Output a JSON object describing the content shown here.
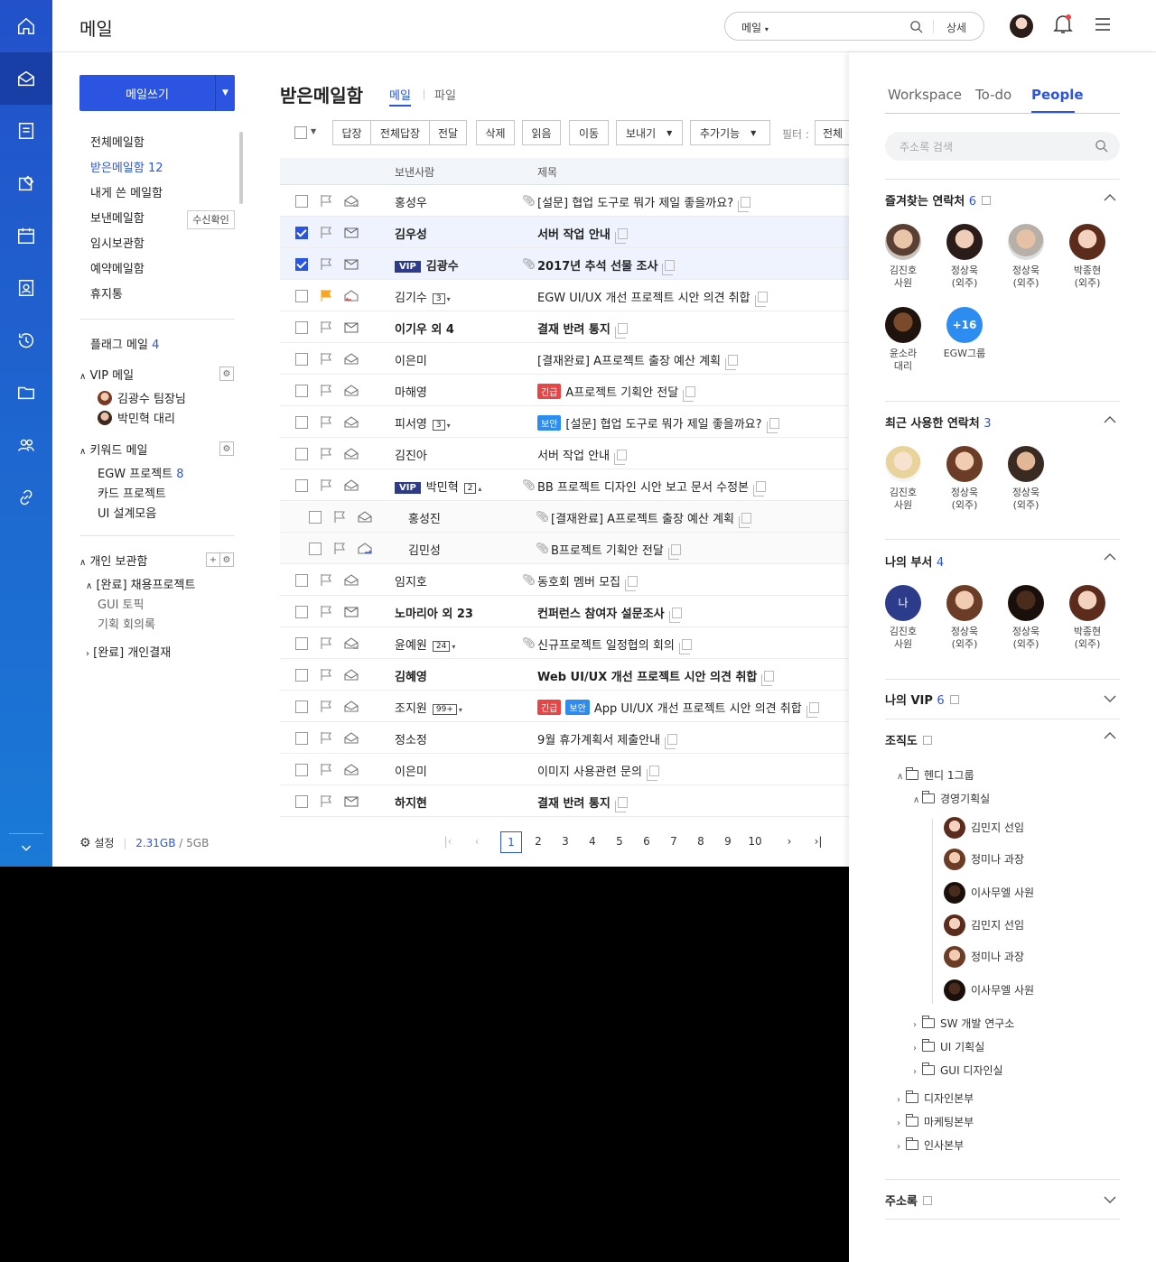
{
  "app": {
    "title": "메일"
  },
  "search": {
    "scope": "메일",
    "detail": "상세"
  },
  "rail": [
    "home-icon",
    "mail-icon",
    "board-icon",
    "approval-icon",
    "calendar-icon",
    "contacts-icon",
    "history-icon",
    "folder-icon",
    "people-icon",
    "link-icon",
    "chevron-down-icon"
  ],
  "compose": {
    "label": "메일쓰기"
  },
  "nav": {
    "items": [
      {
        "label": "전체메일함",
        "count": ""
      },
      {
        "label": "받은메일함",
        "count": "12"
      },
      {
        "label": "내게 쓴 메일함",
        "count": ""
      },
      {
        "label": "보낸메일함",
        "count": ""
      },
      {
        "label": "임시보관함",
        "count": ""
      },
      {
        "label": "예약메일함",
        "count": ""
      },
      {
        "label": "휴지통",
        "count": ""
      }
    ],
    "receipt_button": "수신확인",
    "flag_mail": {
      "label": "플래그 메일",
      "count": "4"
    },
    "vip": {
      "label": "VIP 메일",
      "people": [
        "김광수 팀장님",
        "박민혁 대리"
      ]
    },
    "keyword": {
      "label": "키워드 메일",
      "items": [
        {
          "label": "EGW 프로젝트",
          "count": "8"
        },
        {
          "label": "카드 프로젝트",
          "count": ""
        },
        {
          "label": "UI 설계모음",
          "count": ""
        }
      ]
    },
    "personal": {
      "label": "개인 보관함",
      "group1": "[완료] 채용프로젝트",
      "sub": [
        "GUI 토픽",
        "기획 회의록"
      ],
      "group2": "[완료] 개인결재"
    }
  },
  "footer": {
    "settings": "설정",
    "used": "2.31GB",
    "sep": "/",
    "total": "5GB"
  },
  "mailbox": {
    "title": "받은메일함",
    "tab_mail": "메일",
    "tab_file": "파일"
  },
  "toolbar": {
    "reply": "답장",
    "reply_all": "전체답장",
    "forward": "전달",
    "delete": "삭제",
    "read": "읽음",
    "move": "이동",
    "send": "보내기",
    "more": "추가기능",
    "filter_label": "필터 :",
    "filter_value": "전체"
  },
  "table": {
    "headers": {
      "sender": "보낸사람",
      "subject": "제목"
    },
    "rows": [
      {
        "sender": "홍성우",
        "subject": "[설문] 협업 도구로 뭐가 제일 좋을까요?",
        "bold": false,
        "checked": false,
        "clip": true,
        "flag": false,
        "env": "open-cc",
        "vip": false,
        "count": "",
        "tags": []
      },
      {
        "sender": "김우성",
        "subject": "서버 작업 안내",
        "bold": true,
        "checked": true,
        "clip": false,
        "flag": false,
        "env": "closed",
        "vip": false,
        "count": "",
        "tags": []
      },
      {
        "sender": "김광수",
        "subject": "2017년 추석 선물 조사",
        "bold": true,
        "checked": true,
        "clip": true,
        "flag": false,
        "env": "closed",
        "vip": true,
        "count": "",
        "tags": []
      },
      {
        "sender": "김기수",
        "subject": "EGW UI/UX 개선 프로젝트 시안 의견 취합",
        "bold": false,
        "checked": false,
        "clip": false,
        "flag": true,
        "env": "open-reply",
        "vip": false,
        "count": "3",
        "tags": []
      },
      {
        "sender": "이기우 외 4",
        "subject": "결재 반려 통지",
        "bold": true,
        "checked": false,
        "clip": false,
        "flag": false,
        "env": "closed",
        "vip": false,
        "count": "",
        "tags": []
      },
      {
        "sender": "이은미",
        "subject": "[결재완료] A프로젝트 출장 예산 계획",
        "bold": false,
        "checked": false,
        "clip": false,
        "flag": false,
        "env": "open",
        "vip": false,
        "count": "",
        "tags": []
      },
      {
        "sender": "마해영",
        "subject": "A프로젝트 기획안 전달",
        "bold": false,
        "checked": false,
        "clip": false,
        "flag": false,
        "env": "open",
        "vip": false,
        "count": "",
        "tags": [
          "긴급"
        ]
      },
      {
        "sender": "피서영",
        "subject": "[설문] 협업 도구로 뭐가 제일 좋을까요?",
        "bold": false,
        "checked": false,
        "clip": false,
        "flag": false,
        "env": "open",
        "vip": false,
        "count": "3",
        "tags": [
          "보안"
        ]
      },
      {
        "sender": "김진아",
        "subject": "서버 작업 안내",
        "bold": false,
        "checked": false,
        "clip": false,
        "flag": false,
        "env": "open",
        "vip": false,
        "count": "",
        "tags": []
      },
      {
        "sender": "박민혁",
        "subject": "BB 프로젝트 디자인 시안 보고 문서 수정본",
        "bold": false,
        "checked": false,
        "clip": true,
        "flag": false,
        "env": "open",
        "vip": true,
        "count": "2",
        "tags": []
      },
      {
        "sender": "홍성진",
        "subject": "[결재완료] A프로젝트 출장 예산 계획",
        "bold": false,
        "checked": false,
        "clip": true,
        "flag": false,
        "env": "open",
        "vip": false,
        "count": "",
        "tags": [],
        "child": true
      },
      {
        "sender": "김민성",
        "subject": "B프로젝트 기획안 전달",
        "bold": false,
        "checked": false,
        "clip": true,
        "flag": false,
        "env": "open-fwd",
        "vip": false,
        "count": "",
        "tags": [],
        "child": true
      },
      {
        "sender": "임지호",
        "subject": "동호회 멤버 모집",
        "bold": false,
        "checked": false,
        "clip": true,
        "flag": false,
        "env": "open",
        "vip": false,
        "count": "",
        "tags": []
      },
      {
        "sender": "노마리아 외 23",
        "subject": "컨퍼런스 참여자 설문조사",
        "bold": true,
        "checked": false,
        "clip": false,
        "flag": false,
        "env": "closed",
        "vip": false,
        "count": "",
        "tags": []
      },
      {
        "sender": "윤예원",
        "subject": "신규프로젝트 일정협의 회의",
        "bold": false,
        "checked": false,
        "clip": true,
        "flag": false,
        "env": "open-cc",
        "vip": false,
        "count": "24",
        "tags": []
      },
      {
        "sender": "김혜영",
        "subject": "Web UI/UX 개선 프로젝트 시안 의견 취합",
        "bold": true,
        "checked": false,
        "clip": false,
        "flag": false,
        "env": "open",
        "vip": false,
        "count": "",
        "tags": []
      },
      {
        "sender": "조지원",
        "subject": "App UI/UX 개선 프로젝트 시안 의견 취합",
        "bold": false,
        "checked": false,
        "clip": false,
        "flag": false,
        "env": "open",
        "vip": false,
        "count": "99+",
        "tags": [
          "긴급",
          "보안"
        ]
      },
      {
        "sender": "정소정",
        "subject": "9월 휴가계획서 제출안내",
        "bold": false,
        "checked": false,
        "clip": false,
        "flag": false,
        "env": "open",
        "vip": false,
        "count": "",
        "tags": []
      },
      {
        "sender": "이은미",
        "subject": "이미지 사용관련 문의",
        "bold": false,
        "checked": false,
        "clip": false,
        "flag": false,
        "env": "open",
        "vip": false,
        "count": "",
        "tags": []
      },
      {
        "sender": "하지현",
        "subject": "결재 반려 통지",
        "bold": true,
        "checked": false,
        "clip": false,
        "flag": false,
        "env": "closed",
        "vip": false,
        "count": "",
        "tags": []
      }
    ]
  },
  "pagination": {
    "pages": [
      "1",
      "2",
      "3",
      "4",
      "5",
      "6",
      "7",
      "8",
      "9",
      "10"
    ],
    "current": "1"
  },
  "right": {
    "tabs": [
      "Workspace",
      "To-do",
      "People"
    ],
    "search_placeholder": "주소록 검색",
    "favorites": {
      "label": "즐겨찾는 연락처",
      "count": "6",
      "people": [
        {
          "name": "김진호",
          "role": "사원"
        },
        {
          "name": "정상욱",
          "role": "(외주)"
        },
        {
          "name": "정상욱",
          "role": "(외주)"
        },
        {
          "name": "박종현",
          "role": "(외주)"
        },
        {
          "name": "윤소라",
          "role": "대리"
        },
        {
          "name": "EGW그룹",
          "role": "",
          "badge": "+16"
        }
      ]
    },
    "recent": {
      "label": "최근 사용한 연락처",
      "count": "3",
      "people": [
        {
          "name": "김진호",
          "role": "사원"
        },
        {
          "name": "정상욱",
          "role": "(외주)"
        },
        {
          "name": "정상욱",
          "role": "(외주)"
        }
      ]
    },
    "dept": {
      "label": "나의 부서",
      "count": "4",
      "people": [
        {
          "name": "김진호",
          "role": "사원",
          "badge": "나"
        },
        {
          "name": "정상욱",
          "role": "(외주)"
        },
        {
          "name": "정상욱",
          "role": "(외주)"
        },
        {
          "name": "박종현",
          "role": "(외주)"
        }
      ]
    },
    "myvip": {
      "label": "나의 VIP",
      "count": "6"
    },
    "org": {
      "label": "조직도",
      "root": "헨디 1그룹",
      "sub": "경영기획실",
      "people": [
        "김민지 선임",
        "정미나 과장",
        "이사무엘 사원",
        "김민지 선임",
        "정미나 과장",
        "이사무엘 사원"
      ],
      "subfolders": [
        "SW 개발 연구소",
        "UI 기획실",
        "GUI 디자인실"
      ],
      "folders": [
        "디자인본부",
        "마케팅본부",
        "인사본부"
      ]
    },
    "addressbook": {
      "label": "주소록"
    }
  }
}
